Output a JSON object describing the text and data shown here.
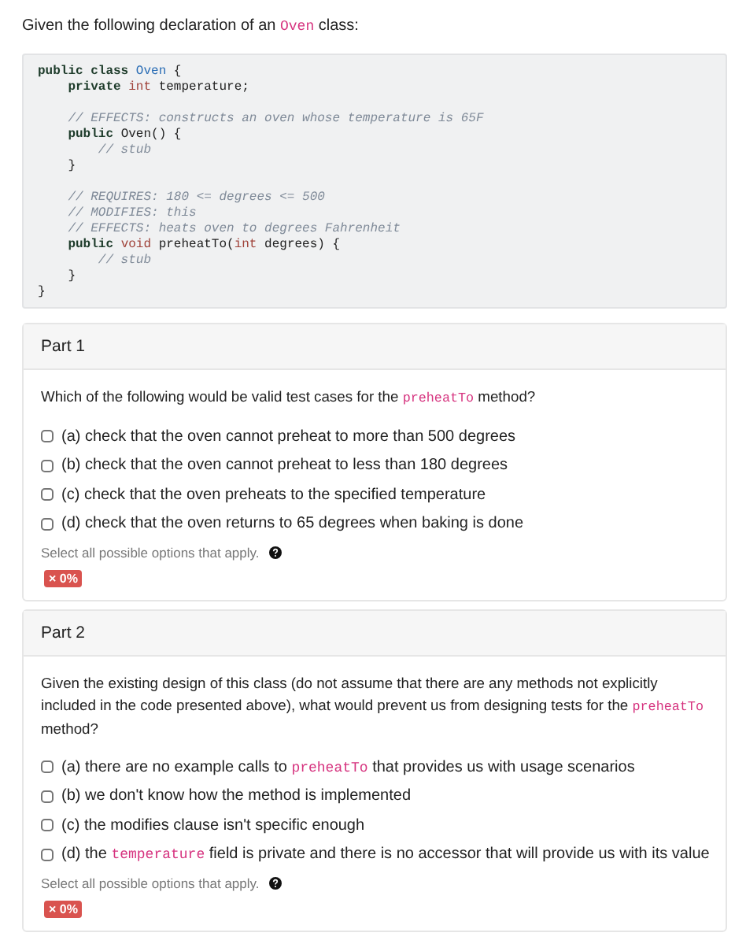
{
  "intro": [
    {
      "text": "Given the following declaration of an ",
      "kind": "plain"
    },
    {
      "text": "Oven",
      "kind": "code"
    },
    {
      "text": " class:",
      "kind": "plain"
    }
  ],
  "code_lines": [
    {
      "tokens": [
        {
          "text": "public class ",
          "kind": "keyword"
        },
        {
          "text": "Oven",
          "kind": "name"
        },
        {
          "text": " {",
          "kind": "plain"
        }
      ]
    },
    {
      "tokens": [
        {
          "text": "    private ",
          "kind": "keyword"
        },
        {
          "text": "int",
          "kind": "type"
        },
        {
          "text": " temperature;",
          "kind": "plain"
        }
      ]
    },
    {
      "kind": "blank"
    },
    {
      "tokens": [
        {
          "text": "    // EFFECTS: constructs an oven whose temperature is 65F",
          "kind": "comment"
        }
      ]
    },
    {
      "tokens": [
        {
          "text": "    public ",
          "kind": "keyword"
        },
        {
          "text": "Oven() {",
          "kind": "plain"
        }
      ]
    },
    {
      "tokens": [
        {
          "text": "        // stub",
          "kind": "comment"
        }
      ]
    },
    {
      "tokens": [
        {
          "text": "    }",
          "kind": "plain"
        }
      ]
    },
    {
      "kind": "blank"
    },
    {
      "tokens": [
        {
          "text": "    // REQUIRES: 180 <= degrees <= 500",
          "kind": "comment"
        }
      ]
    },
    {
      "tokens": [
        {
          "text": "    // MODIFIES: this",
          "kind": "comment"
        }
      ]
    },
    {
      "tokens": [
        {
          "text": "    // EFFECTS: heats oven to degrees Fahrenheit",
          "kind": "comment"
        }
      ]
    },
    {
      "tokens": [
        {
          "text": "    public ",
          "kind": "keyword"
        },
        {
          "text": "void",
          "kind": "type"
        },
        {
          "text": " preheatTo(",
          "kind": "plain"
        },
        {
          "text": "int",
          "kind": "type"
        },
        {
          "text": " degrees) {",
          "kind": "plain"
        }
      ]
    },
    {
      "tokens": [
        {
          "text": "        // stub",
          "kind": "comment"
        }
      ]
    },
    {
      "tokens": [
        {
          "text": "    }",
          "kind": "plain"
        }
      ]
    },
    {
      "tokens": [
        {
          "text": "}",
          "kind": "plain"
        }
      ]
    }
  ],
  "parts": [
    {
      "title": "Part 1",
      "question": [
        {
          "text": "Which of the following would be valid test cases for the ",
          "kind": "plain"
        },
        {
          "text": "preheatTo",
          "kind": "code"
        },
        {
          "text": " method?",
          "kind": "plain"
        }
      ],
      "options": [
        {
          "checked": false,
          "label": [
            {
              "text": "(a) check that the oven cannot preheat to more than 500 degrees",
              "kind": "plain"
            }
          ]
        },
        {
          "checked": false,
          "label": [
            {
              "text": "(b) check that the oven cannot preheat to less than 180 degrees",
              "kind": "plain"
            }
          ]
        },
        {
          "checked": false,
          "label": [
            {
              "text": "(c) check that the oven preheats to the specified temperature",
              "kind": "plain"
            }
          ]
        },
        {
          "checked": false,
          "label": [
            {
              "text": "(d) check that the oven returns to 65 degrees when baking is done",
              "kind": "plain"
            }
          ]
        }
      ],
      "hint": "Select all possible options that apply.",
      "result": {
        "kind": "incorrect",
        "text": "× 0%"
      }
    },
    {
      "title": "Part 2",
      "question": [
        {
          "text": "Given the existing design of this class (do not assume that there are any methods not explicitly included in the code presented above), what would prevent us from designing tests for the ",
          "kind": "plain"
        },
        {
          "text": "preheatTo",
          "kind": "code"
        },
        {
          "text": " method?",
          "kind": "plain"
        }
      ],
      "options": [
        {
          "checked": false,
          "label": [
            {
              "text": "(a) there are no example calls to ",
              "kind": "plain"
            },
            {
              "text": "preheatTo",
              "kind": "code"
            },
            {
              "text": " that provides us with usage scenarios",
              "kind": "plain"
            }
          ]
        },
        {
          "checked": false,
          "label": [
            {
              "text": "(b) we don't know how the method is implemented",
              "kind": "plain"
            }
          ]
        },
        {
          "checked": false,
          "label": [
            {
              "text": "(c) the modifies clause isn't specific enough",
              "kind": "plain"
            }
          ]
        },
        {
          "checked": false,
          "label": [
            {
              "text": "(d) the ",
              "kind": "plain"
            },
            {
              "text": "temperature",
              "kind": "code"
            },
            {
              "text": " field is private and there is no accessor that will provide us with its value",
              "kind": "plain"
            }
          ]
        }
      ],
      "hint": "Select all possible options that apply.",
      "result": {
        "kind": "incorrect",
        "text": "× 0%"
      }
    }
  ]
}
